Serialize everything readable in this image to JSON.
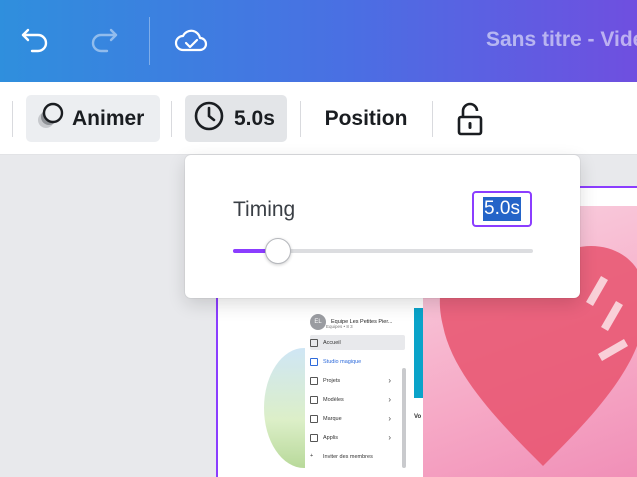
{
  "header": {
    "title": "Sans titre - Vidéo",
    "icons": {
      "undo": "undo-icon",
      "redo": "redo-icon",
      "cloud": "cloud-check-icon"
    }
  },
  "toolbar": {
    "animate_label": "Animer",
    "timing_label": "5.0s",
    "position_label": "Position",
    "icons": {
      "animate": "animate-circles-icon",
      "timing": "clock-icon",
      "lock": "unlock-icon"
    }
  },
  "popover": {
    "label": "Timing",
    "value": "5.0s",
    "slider_fraction": 0.15,
    "accent": "#8b3dff"
  },
  "preview": {
    "team_initials": "EL",
    "team_name": "Equipe Les Petites Pier...",
    "team_sub": "Equipes • 8 3",
    "items": [
      {
        "label": "Accueil",
        "chevron": false
      },
      {
        "label": "Studio magique",
        "chevron": false
      },
      {
        "label": "Projets",
        "chevron": true
      },
      {
        "label": "Modèles",
        "chevron": true
      },
      {
        "label": "Marque",
        "chevron": true
      },
      {
        "label": "Applis",
        "chevron": true
      },
      {
        "label": "Inviter des membres",
        "chevron": false
      }
    ],
    "side_label": "Vo"
  },
  "colors": {
    "accent": "#8b3dff",
    "selection": "#2464c8"
  }
}
